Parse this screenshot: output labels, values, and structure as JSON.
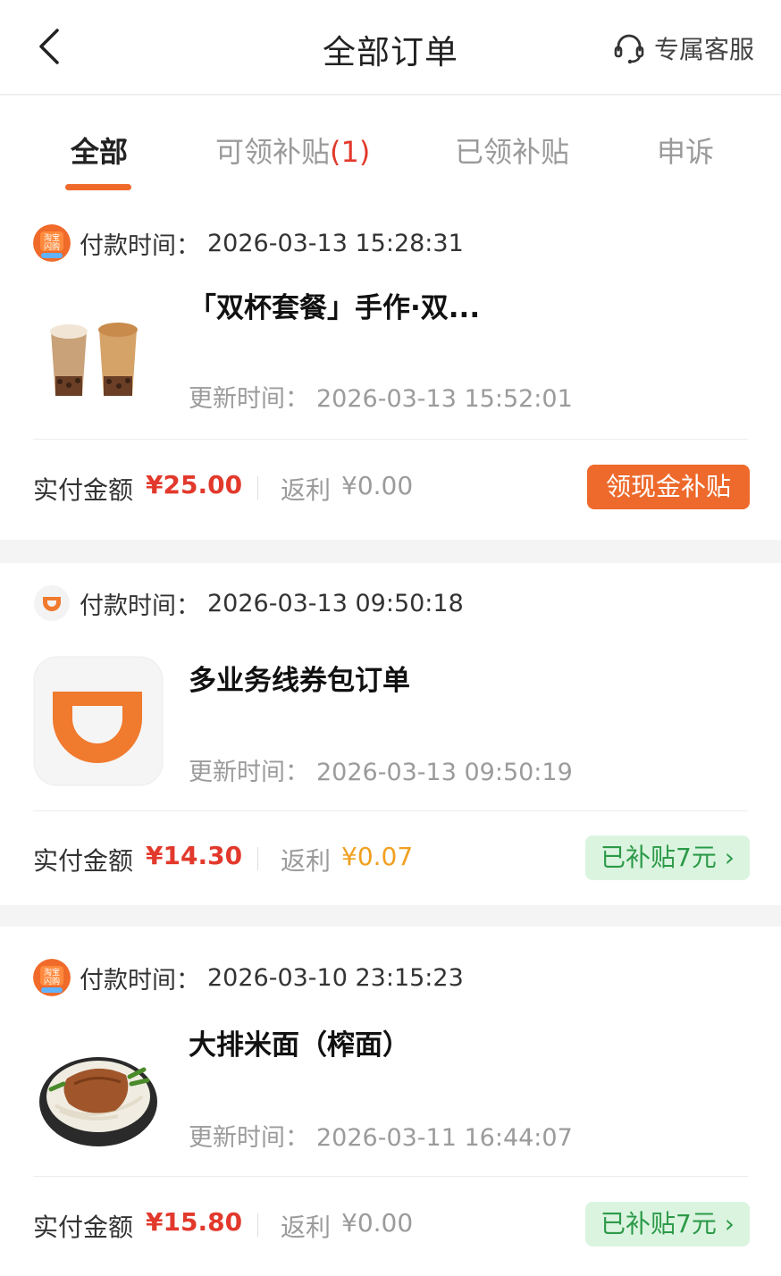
{
  "header": {
    "title": "全部订单",
    "service_label": "专属客服"
  },
  "tabs": [
    {
      "label": "全部"
    },
    {
      "label": "可领补贴",
      "count": "(1)"
    },
    {
      "label": "已领补贴"
    },
    {
      "label": "申诉"
    }
  ],
  "colors": {
    "accent": "#ef6a2a",
    "price_red": "#e2392c",
    "subsidy_green": "#2c9a48",
    "subsidy_green_bg": "#dbf4e0",
    "rebate_gold": "#f0a020"
  },
  "orders": [
    {
      "store_icon": "taobao-flash-logo",
      "pay_label": "付款时间：",
      "pay_time": "2026-03-13 15:28:31",
      "product_name": "「双杯套餐」手作·双...",
      "thumb": "milk-tea-cups-image",
      "update_label": "更新时间：",
      "update_time": "2026-03-13 15:52:01",
      "paid_label": "实付金额",
      "paid_amount": "¥25.00",
      "rebate_label": "返利",
      "rebate_amount": "¥0.00",
      "action_label": "领现金补贴"
    },
    {
      "store_icon": "didi-logo",
      "pay_label": "付款时间：",
      "pay_time": "2026-03-13 09:50:18",
      "product_name": "多业务线券包订单",
      "thumb": "didi-app-icon",
      "update_label": "更新时间：",
      "update_time": "2026-03-13 09:50:19",
      "paid_label": "实付金额",
      "paid_amount": "¥14.30",
      "rebate_label": "返利",
      "rebate_amount": "¥0.07",
      "action_label": "已补贴7元 ›"
    },
    {
      "store_icon": "taobao-flash-logo",
      "pay_label": "付款时间：",
      "pay_time": "2026-03-10 23:15:23",
      "product_name": "大排米面（榨面）",
      "thumb": "noodle-bowl-image",
      "update_label": "更新时间：",
      "update_time": "2026-03-11 16:44:07",
      "paid_label": "实付金额",
      "paid_amount": "¥15.80",
      "rebate_label": "返利",
      "rebate_amount": "¥0.00",
      "action_label": "已补贴7元 ›"
    }
  ]
}
